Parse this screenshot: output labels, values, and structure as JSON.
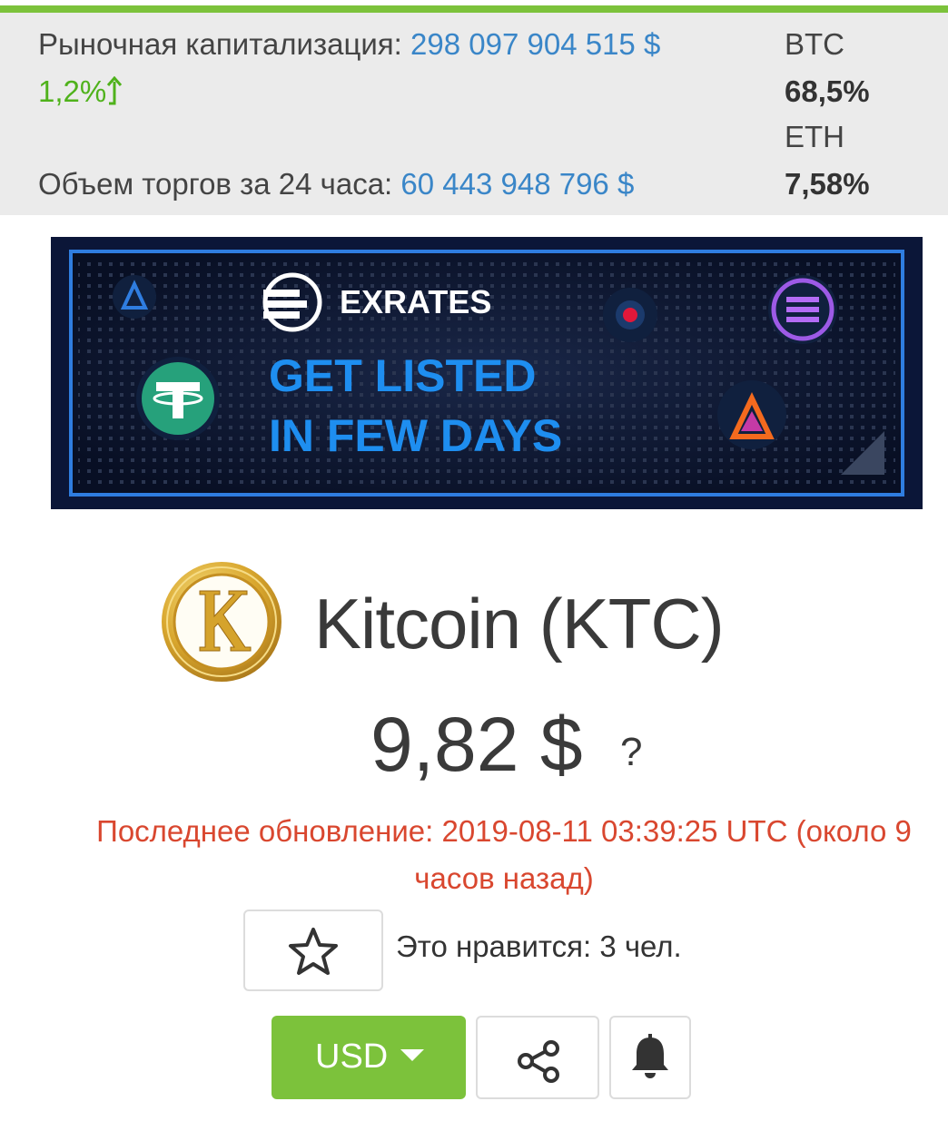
{
  "market": {
    "cap_label": "Рыночная капитализация:",
    "cap_value": "298 097 904 515 $",
    "cap_change": "1,2%",
    "volume_label": "Объем торгов за 24 часа:",
    "volume_value": "60 443 948 796 $",
    "dominance": [
      {
        "name": "BTC",
        "value": "68,5%"
      },
      {
        "name": "ETH",
        "value": "7,58%"
      }
    ]
  },
  "banner": {
    "brand": "EXRATES",
    "line1": "GET LISTED",
    "line2": "IN FEW DAYS"
  },
  "coin": {
    "name": "Kitcoin (KTC)",
    "price": "9,82 $",
    "price_help": "?",
    "last_update": "Последнее обновление: 2019-08-11 03:39:25 UTC (около 9 часов назад)",
    "likes": "Это нравится: 3 чел."
  },
  "actions": {
    "currency": "USD"
  },
  "colors": {
    "accent_green": "#7cc23b",
    "link_blue": "#3a86c8",
    "positive": "#4fb21b",
    "alert_red": "#d9472f"
  }
}
